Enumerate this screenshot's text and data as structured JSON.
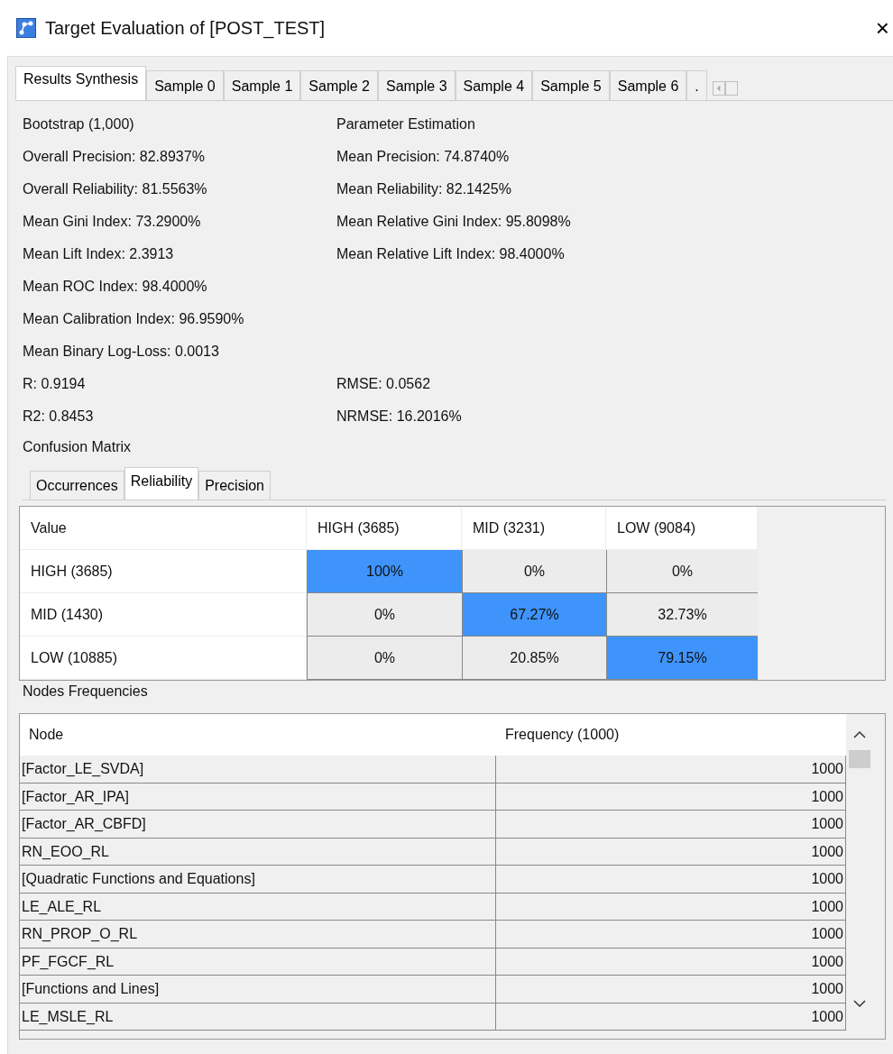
{
  "window": {
    "title": "Target Evaluation of  [POST_TEST]",
    "close": "×"
  },
  "tabs": [
    {
      "label": "Results Synthesis",
      "selected": true
    },
    {
      "label": "Sample 0",
      "selected": false
    },
    {
      "label": "Sample 1",
      "selected": false
    },
    {
      "label": "Sample 2",
      "selected": false
    },
    {
      "label": "Sample 3",
      "selected": false
    },
    {
      "label": "Sample 4",
      "selected": false
    },
    {
      "label": "Sample 5",
      "selected": false
    },
    {
      "label": "Sample 6",
      "selected": false
    },
    {
      "label": ".",
      "selected": false
    }
  ],
  "stats": [
    {
      "left": "Bootstrap (1,000)",
      "right": "Parameter Estimation"
    },
    {
      "left": "Overall Precision: 82.8937%",
      "right": "Mean Precision: 74.8740%"
    },
    {
      "left": "Overall Reliability: 81.5563%",
      "right": "Mean Reliability: 82.1425%"
    },
    {
      "left": "Mean Gini Index: 73.2900%",
      "right": "Mean Relative Gini Index: 95.8098%"
    },
    {
      "left": "Mean Lift Index: 2.3913",
      "right": "Mean Relative Lift Index: 98.4000%"
    },
    {
      "left": "Mean ROC Index: 98.4000%"
    },
    {
      "left": "Mean Calibration Index: 96.9590%"
    },
    {
      "left": "Mean Binary Log-Loss: 0.0013"
    },
    {
      "left": "R: 0.9194",
      "right": "RMSE: 0.0562"
    },
    {
      "left": "R2: 0.8453",
      "right": "NRMSE: 16.2016%"
    }
  ],
  "confusion_matrix": {
    "title": "Confusion Matrix",
    "tabs": [
      {
        "label": "Occurrences",
        "selected": false
      },
      {
        "label": "Reliability",
        "selected": true
      },
      {
        "label": "Precision",
        "selected": false
      }
    ],
    "columns": [
      "Value",
      "HIGH (3685)",
      "MID (3231)",
      "LOW (9084)"
    ],
    "rows": [
      {
        "cells": [
          {
            "value": "HIGH (3685)",
            "kind": "header",
            "highlighted": false
          },
          {
            "value": "100%",
            "kind": "value",
            "highlighted": true
          },
          {
            "value": "0%",
            "kind": "value",
            "highlighted": false
          },
          {
            "value": "0%",
            "kind": "value",
            "highlighted": false
          }
        ]
      },
      {
        "cells": [
          {
            "value": "MID (1430)",
            "kind": "header",
            "highlighted": false
          },
          {
            "value": "0%",
            "kind": "value",
            "highlighted": false
          },
          {
            "value": "67.27%",
            "kind": "value",
            "highlighted": true
          },
          {
            "value": "32.73%",
            "kind": "value",
            "highlighted": false
          }
        ]
      },
      {
        "cells": [
          {
            "value": "LOW (10885)",
            "kind": "header",
            "highlighted": false
          },
          {
            "value": "0%",
            "kind": "value",
            "highlighted": false
          },
          {
            "value": "20.85%",
            "kind": "value",
            "highlighted": false
          },
          {
            "value": "79.15%",
            "kind": "value",
            "highlighted": true
          }
        ]
      }
    ]
  },
  "nodes_frequencies": {
    "title": "Nodes Frequencies",
    "columns": [
      "Node",
      "Frequency (1000)"
    ],
    "rows": [
      {
        "node": "[Factor_LE_SVDA]",
        "frequency": "1000"
      },
      {
        "node": "[Factor_AR_IPA]",
        "frequency": "1000"
      },
      {
        "node": "[Factor_AR_CBFD]",
        "frequency": "1000"
      },
      {
        "node": "RN_EOO_RL",
        "frequency": "1000"
      },
      {
        "node": "[Quadratic Functions and Equations]",
        "frequency": "1000"
      },
      {
        "node": "LE_ALE_RL",
        "frequency": "1000"
      },
      {
        "node": "RN_PROP_O_RL",
        "frequency": "1000"
      },
      {
        "node": "PF_FGCF_RL",
        "frequency": "1000"
      },
      {
        "node": "[Functions and Lines]",
        "frequency": "1000"
      },
      {
        "node": "LE_MSLE_RL",
        "frequency": "1000"
      }
    ]
  }
}
